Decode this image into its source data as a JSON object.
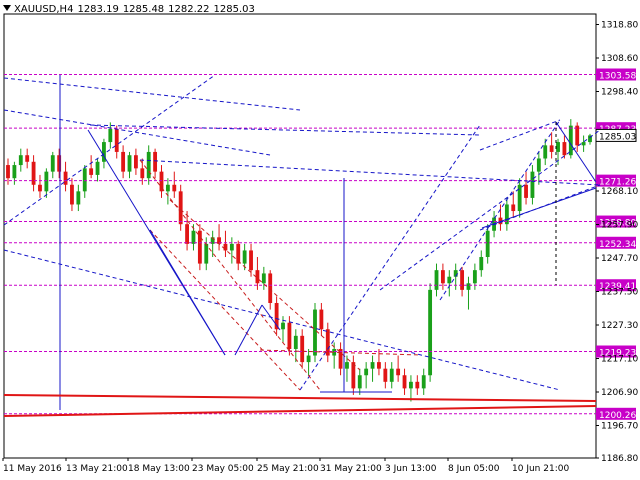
{
  "header": {
    "symbol_timeframe": "XAUUSD,H4",
    "open": "1283.19",
    "high": "1285.48",
    "low": "1282.22",
    "close": "1285.03"
  },
  "colors": {
    "background": "#ffffff",
    "bull_candle": "#1aa01a",
    "bear_candle": "#e01515",
    "trend_blue": "#1515c8",
    "level_magenta": "#c800c8",
    "price_tag_bg": "#c800c8",
    "price_tag_text": "#ffffff",
    "support_red": "#e01515",
    "channel_red": "#c81e1e"
  },
  "chart_data": {
    "type": "candlestick",
    "symbol": "XAUUSD",
    "timeframe": "H4",
    "y_axis_ticks": [
      "1318.80",
      "1308.60",
      "1298.40",
      "1285.03",
      "1268.10",
      "1257.90",
      "1247.70",
      "1237.50",
      "1227.30",
      "1217.10",
      "1206.90",
      "1196.70",
      "1186.80"
    ],
    "x_axis_ticks": [
      "11 May 2016",
      "13 May 21:00",
      "18 May 13:00",
      "23 May 05:00",
      "25 May 21:00",
      "31 May 21:00",
      "3 Jun 13:00",
      "8 Jun 05:00",
      "10 Jun 21:00"
    ],
    "current_price": "1285.03",
    "horizontal_levels": [
      {
        "label": "1303.58",
        "value": 1303.58
      },
      {
        "label": "1287.23",
        "value": 1287.23
      },
      {
        "label": "1271.26",
        "value": 1271.26
      },
      {
        "label": "1258.80",
        "value": 1258.8
      },
      {
        "label": "1252.34",
        "value": 1252.34
      },
      {
        "label": "1239.41",
        "value": 1239.41
      },
      {
        "label": "1219.23",
        "value": 1219.23
      },
      {
        "label": "1200.26",
        "value": 1200.26
      }
    ],
    "y_range": [
      1186.8,
      1322.0
    ],
    "candles": [
      [
        1276,
        1278,
        1270,
        1272
      ],
      [
        1272,
        1277,
        1270,
        1276
      ],
      [
        1276,
        1281,
        1274,
        1279
      ],
      [
        1279,
        1281,
        1275,
        1277
      ],
      [
        1277,
        1279,
        1268,
        1270
      ],
      [
        1270,
        1273,
        1266,
        1268
      ],
      [
        1268,
        1275,
        1266,
        1274
      ],
      [
        1274,
        1280,
        1272,
        1279
      ],
      [
        1279,
        1281,
        1272,
        1274
      ],
      [
        1274,
        1277,
        1268,
        1270
      ],
      [
        1270,
        1272,
        1262,
        1264
      ],
      [
        1264,
        1270,
        1262,
        1268
      ],
      [
        1268,
        1276,
        1266,
        1275
      ],
      [
        1275,
        1279,
        1272,
        1273
      ],
      [
        1273,
        1278,
        1271,
        1277
      ],
      [
        1277,
        1284,
        1275,
        1283
      ],
      [
        1283,
        1289,
        1281,
        1287
      ],
      [
        1287,
        1288,
        1278,
        1280
      ],
      [
        1280,
        1282,
        1272,
        1274
      ],
      [
        1274,
        1280,
        1272,
        1279
      ],
      [
        1279,
        1281,
        1273,
        1275
      ],
      [
        1275,
        1278,
        1270,
        1272
      ],
      [
        1272,
        1282,
        1270,
        1280
      ],
      [
        1280,
        1281,
        1272,
        1274
      ],
      [
        1274,
        1276,
        1266,
        1268
      ],
      [
        1268,
        1272,
        1264,
        1270
      ],
      [
        1270,
        1274,
        1266,
        1268
      ],
      [
        1268,
        1270,
        1256,
        1258
      ],
      [
        1258,
        1262,
        1250,
        1252
      ],
      [
        1252,
        1258,
        1250,
        1256
      ],
      [
        1256,
        1258,
        1244,
        1246
      ],
      [
        1246,
        1254,
        1244,
        1252
      ],
      [
        1252,
        1256,
        1248,
        1254
      ],
      [
        1254,
        1258,
        1250,
        1252
      ],
      [
        1252,
        1256,
        1248,
        1250
      ],
      [
        1250,
        1254,
        1246,
        1252
      ],
      [
        1252,
        1253,
        1244,
        1246
      ],
      [
        1246,
        1252,
        1244,
        1250
      ],
      [
        1250,
        1252,
        1242,
        1244
      ],
      [
        1244,
        1248,
        1238,
        1240
      ],
      [
        1240,
        1245,
        1238,
        1243
      ],
      [
        1243,
        1244,
        1232,
        1234
      ],
      [
        1234,
        1236,
        1224,
        1226
      ],
      [
        1226,
        1230,
        1222,
        1228
      ],
      [
        1228,
        1230,
        1218,
        1220
      ],
      [
        1220,
        1226,
        1216,
        1224
      ],
      [
        1224,
        1226,
        1214,
        1216
      ],
      [
        1216,
        1220,
        1212,
        1218
      ],
      [
        1218,
        1234,
        1216,
        1232
      ],
      [
        1232,
        1234,
        1224,
        1226
      ],
      [
        1226,
        1228,
        1216,
        1218
      ],
      [
        1218,
        1222,
        1214,
        1220
      ],
      [
        1220,
        1222,
        1212,
        1214
      ],
      [
        1214,
        1218,
        1210,
        1216
      ],
      [
        1216,
        1218,
        1206,
        1208
      ],
      [
        1208,
        1214,
        1206,
        1212
      ],
      [
        1212,
        1216,
        1208,
        1214
      ],
      [
        1214,
        1218,
        1210,
        1216
      ],
      [
        1216,
        1220,
        1212,
        1214
      ],
      [
        1214,
        1216,
        1208,
        1210
      ],
      [
        1210,
        1216,
        1208,
        1214
      ],
      [
        1214,
        1218,
        1210,
        1212
      ],
      [
        1212,
        1214,
        1206,
        1208
      ],
      [
        1208,
        1212,
        1204,
        1210
      ],
      [
        1210,
        1212,
        1206,
        1208
      ],
      [
        1208,
        1214,
        1206,
        1212
      ],
      [
        1212,
        1240,
        1210,
        1238
      ],
      [
        1238,
        1246,
        1236,
        1244
      ],
      [
        1244,
        1246,
        1238,
        1240
      ],
      [
        1240,
        1244,
        1236,
        1242
      ],
      [
        1242,
        1246,
        1238,
        1244
      ],
      [
        1244,
        1245,
        1236,
        1238
      ],
      [
        1238,
        1242,
        1232,
        1240
      ],
      [
        1240,
        1246,
        1238,
        1244
      ],
      [
        1244,
        1250,
        1242,
        1248
      ],
      [
        1248,
        1258,
        1246,
        1256
      ],
      [
        1256,
        1262,
        1254,
        1260
      ],
      [
        1260,
        1264,
        1256,
        1258
      ],
      [
        1258,
        1266,
        1256,
        1264
      ],
      [
        1264,
        1268,
        1260,
        1262
      ],
      [
        1262,
        1272,
        1260,
        1270
      ],
      [
        1270,
        1274,
        1264,
        1266
      ],
      [
        1266,
        1276,
        1264,
        1274
      ],
      [
        1274,
        1280,
        1270,
        1278
      ],
      [
        1278,
        1284,
        1276,
        1282
      ],
      [
        1282,
        1286,
        1278,
        1280
      ],
      [
        1280,
        1284,
        1276,
        1283
      ],
      [
        1283,
        1285,
        1278,
        1279
      ],
      [
        1279,
        1290,
        1278,
        1288
      ],
      [
        1288,
        1289,
        1280,
        1282
      ],
      [
        1282,
        1285,
        1280,
        1283
      ],
      [
        1283,
        1285.48,
        1282.22,
        1285.03
      ]
    ]
  }
}
